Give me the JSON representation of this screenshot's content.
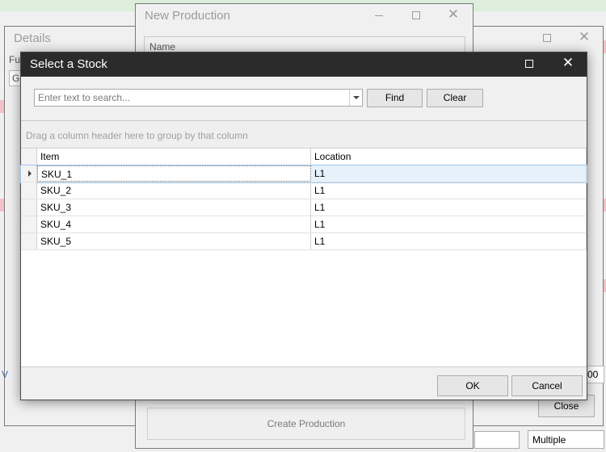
{
  "background": {
    "details_window": {
      "title": "Details",
      "fragment_label": "Fu",
      "fragment_value": "G",
      "close_label": "Close",
      "side_fragment": "00",
      "left_fragment": "V"
    },
    "production_window": {
      "title": "New Production",
      "name_label": "Name",
      "create_label": "Create Production"
    },
    "multiple_field": {
      "value": "Multiple"
    }
  },
  "dialog": {
    "title": "Select a Stock",
    "search": {
      "placeholder": "Enter text to search...",
      "value": ""
    },
    "find_label": "Find",
    "clear_label": "Clear",
    "group_panel_text": "Drag a column header here to group by that column",
    "columns": [
      "Item",
      "Location"
    ],
    "rows": [
      {
        "item": "SKU_1",
        "location": "L1",
        "selected": true
      },
      {
        "item": "SKU_2",
        "location": "L1"
      },
      {
        "item": "SKU_3",
        "location": "L1"
      },
      {
        "item": "SKU_4",
        "location": "L1"
      },
      {
        "item": "SKU_5",
        "location": "L1"
      }
    ],
    "ok_label": "OK",
    "cancel_label": "Cancel"
  },
  "icons": [
    "minimize-icon",
    "maximize-icon",
    "close-icon",
    "chevron-down-icon",
    "row-indicator-icon"
  ],
  "colors": {
    "title_bar": "#2b2b2b",
    "selection": "#e5f1fb",
    "background": "#f0f0f0"
  }
}
